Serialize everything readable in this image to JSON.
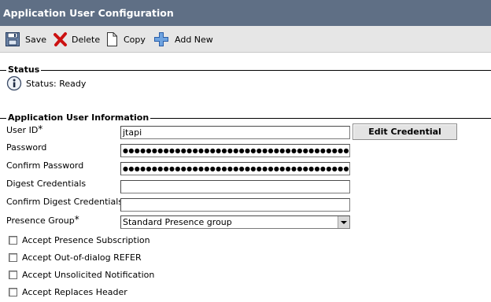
{
  "header": {
    "title": "Application User Configuration"
  },
  "toolbar": {
    "save_label": "Save",
    "delete_label": "Delete",
    "copy_label": "Copy",
    "add_new_label": "Add New"
  },
  "status_section": {
    "legend": "Status",
    "status_text": "Status: Ready"
  },
  "info_section": {
    "legend": "Application User Information",
    "user_id": {
      "label": "User ID",
      "required_mark": "*",
      "value": "jtapi"
    },
    "edit_credential_label": "Edit Credential",
    "password": {
      "label": "Password",
      "masked": "●●●●●●●●●●●●●●●●●●●●●●●●●●●●●●●●●●●●●●●●●●●●●●●●●"
    },
    "confirm_password": {
      "label": "Confirm Password",
      "masked": "●●●●●●●●●●●●●●●●●●●●●●●●●●●●●●●●●●●●●●●●●●●●●●●●●"
    },
    "digest_credentials": {
      "label": "Digest Credentials",
      "value": ""
    },
    "confirm_digest_credentials": {
      "label": "Confirm Digest Credentials",
      "value": ""
    },
    "presence_group": {
      "label": "Presence Group",
      "required_mark": "*",
      "selected": "Standard Presence group"
    },
    "checkboxes": [
      {
        "label": "Accept Presence Subscription",
        "checked": false
      },
      {
        "label": "Accept Out-of-dialog REFER",
        "checked": false
      },
      {
        "label": "Accept Unsolicited Notification",
        "checked": false
      },
      {
        "label": "Accept Replaces Header",
        "checked": false
      }
    ]
  },
  "colors": {
    "title_bar": "#5f6f85",
    "toolbar_bg": "#e6e6e6",
    "delete_icon": "#cc1111",
    "add_icon": "#3a78c8"
  }
}
